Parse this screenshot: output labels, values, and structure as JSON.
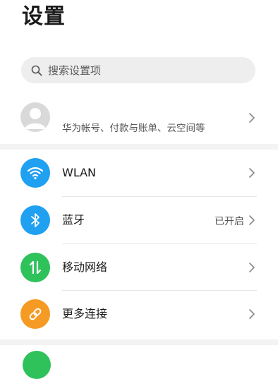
{
  "header": {
    "title": "设置"
  },
  "search": {
    "placeholder": "搜索设置项"
  },
  "account": {
    "subtitle": "华为帐号、付款与账单、云空间等"
  },
  "items": [
    {
      "label": "WLAN",
      "value": "",
      "icon": "wifi-icon",
      "color": "#1fa0f0"
    },
    {
      "label": "蓝牙",
      "value": "已开启",
      "icon": "bluetooth-icon",
      "color": "#1fa0f0"
    },
    {
      "label": "移动网络",
      "value": "",
      "icon": "mobile-network-icon",
      "color": "#2fc25b"
    },
    {
      "label": "更多连接",
      "value": "",
      "icon": "link-icon",
      "color": "#f59a22"
    }
  ],
  "next_icon_color": "#2fc25b"
}
